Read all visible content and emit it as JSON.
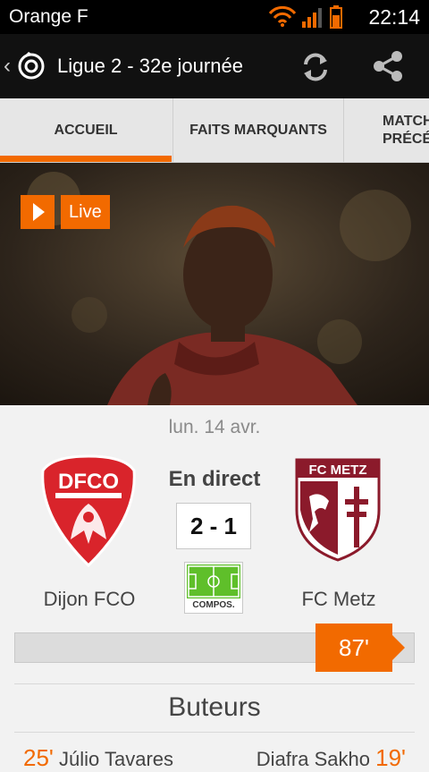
{
  "status_bar": {
    "carrier": "Orange F",
    "time": "22:14",
    "icons": [
      "wifi-icon",
      "signal-icon",
      "battery-icon"
    ]
  },
  "header": {
    "title": "Ligue 2 - 32e journée",
    "icons": [
      "back-chevron-icon",
      "ligue-logo-icon",
      "refresh-icon",
      "share-icon"
    ]
  },
  "tabs": [
    {
      "label": "ACCUEIL",
      "active": true
    },
    {
      "label": "FAITS MARQUANTS",
      "active": false
    },
    {
      "label": "MATCHS PRÉCÉDENTS",
      "active": false
    }
  ],
  "hero": {
    "live_label": "Live"
  },
  "match": {
    "date": "lun. 14 avr.",
    "status": "En direct",
    "score": "2 - 1",
    "home_team": "Dijon FCO",
    "away_team": "FC Metz",
    "compos_label": "COMPOS.",
    "minute": "87'",
    "progress_fraction": 0.967
  },
  "scorers": {
    "title": "Buteurs",
    "home": [
      {
        "minute": "25'",
        "name": "Júlio Tavares"
      }
    ],
    "away": [
      {
        "minute": "19'",
        "name": "Diafra Sakho"
      }
    ]
  },
  "colors": {
    "accent": "#f26a00",
    "header_bg": "#111111",
    "dijon_red": "#d9242b",
    "metz_maroon": "#8b1a2b"
  }
}
